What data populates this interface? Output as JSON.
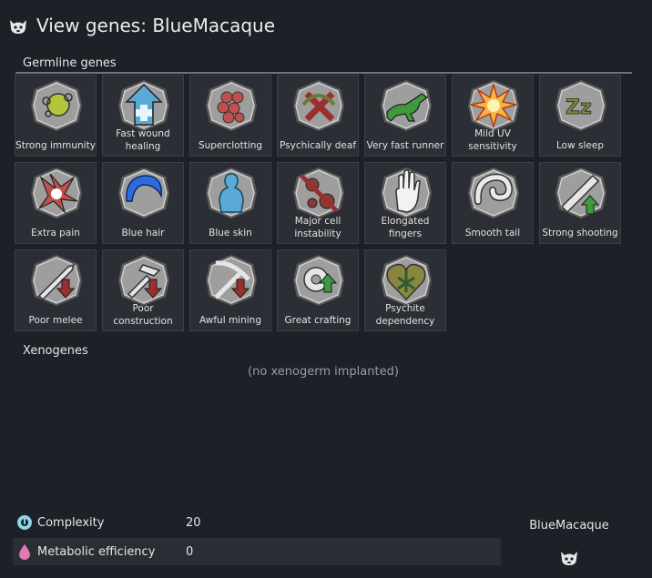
{
  "window": {
    "title": "View genes: BlueMacaque",
    "icon": "macaque-head-icon"
  },
  "germline": {
    "header": "Germline genes",
    "genes": [
      {
        "label": "Strong immunity",
        "icon": "immunity-cells-icon"
      },
      {
        "label": "Fast wound\nhealing",
        "icon": "wound-healing-arrow-icon"
      },
      {
        "label": "Superclotting",
        "icon": "clotting-cells-icon"
      },
      {
        "label": "Psychically deaf",
        "icon": "psychic-deaf-icon"
      },
      {
        "label": "Very fast runner",
        "icon": "running-animal-icon"
      },
      {
        "label": "Mild UV\nsensitivity",
        "icon": "uv-burst-icon"
      },
      {
        "label": "Low sleep",
        "icon": "sleep-zz-icon"
      },
      {
        "label": "Extra pain",
        "icon": "pain-burst-icon"
      },
      {
        "label": "Blue hair",
        "icon": "hair-icon"
      },
      {
        "label": "Blue skin",
        "icon": "skin-body-icon"
      },
      {
        "label": "Major cell\ninstability",
        "icon": "cell-instability-icon"
      },
      {
        "label": "Elongated\nfingers",
        "icon": "hand-icon"
      },
      {
        "label": "Smooth tail",
        "icon": "tail-icon"
      },
      {
        "label": "Strong shooting",
        "icon": "rifle-up-icon"
      },
      {
        "label": "Poor melee",
        "icon": "sword-down-icon"
      },
      {
        "label": "Poor\nconstruction",
        "icon": "hammer-down-icon"
      },
      {
        "label": "Awful mining",
        "icon": "pickaxe-down-icon"
      },
      {
        "label": "Great crafting",
        "icon": "gear-up-icon"
      },
      {
        "label": "Psychite\ndependency",
        "icon": "psychite-leaf-heart-icon"
      }
    ]
  },
  "xenogenes": {
    "header": "Xenogenes",
    "empty_text": "(no xenogerm implanted)"
  },
  "stats": [
    {
      "label": "Complexity",
      "value": "20",
      "icon": "complexity-icon",
      "color": "#8fd3e6"
    },
    {
      "label": "Metabolic efficiency",
      "value": "0",
      "icon": "metabolic-drop-icon",
      "color": "#e07ab0"
    }
  ],
  "xenotype": {
    "name": "BlueMacaque",
    "icon": "macaque-head-icon"
  },
  "colors": {
    "background": "#1d2026",
    "tile": "#2b2e34",
    "hex_fill": "#9e9e9e",
    "green_arrow": "#3e9a3e",
    "red_arrow": "#9b2f2f",
    "blue": "#2f6be0",
    "skin_blue": "#5aa9d6"
  }
}
